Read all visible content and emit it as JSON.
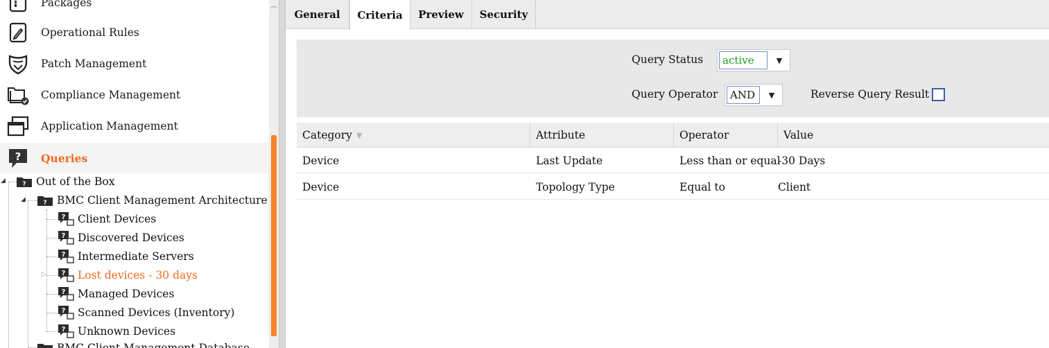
{
  "nav": {
    "items": [
      {
        "label": "Packages",
        "icon": "package-icon"
      },
      {
        "label": "Operational Rules",
        "icon": "operational-rules-icon"
      },
      {
        "label": "Patch Management",
        "icon": "shield-icon"
      },
      {
        "label": "Compliance Management",
        "icon": "compliance-folder-icon"
      },
      {
        "label": "Application Management",
        "icon": "application-windows-icon"
      },
      {
        "label": "Queries",
        "icon": "query-bubble-icon",
        "active": true
      }
    ]
  },
  "tree": {
    "root": "Out of the Box",
    "group": "BMC Client Management Architecture",
    "children": [
      "Client Devices",
      "Discovered Devices",
      "Intermediate Servers",
      "Lost devices - 30 days",
      "Managed Devices",
      "Scanned Devices (Inventory)",
      "Unknown Devices"
    ],
    "selected": "Lost devices - 30 days",
    "next_group": "BMC Client Management Database"
  },
  "tabs": [
    "General",
    "Criteria",
    "Preview",
    "Security"
  ],
  "active_tab": "Criteria",
  "criteria": {
    "status_label": "Query Status",
    "status_value": "active",
    "operator_label": "Query Operator",
    "operator_value": "AND",
    "reverse_label": "Reverse Query Result",
    "reverse_checked": false
  },
  "grid": {
    "headers": [
      "Category",
      "Attribute",
      "Operator",
      "Value"
    ],
    "rows": [
      [
        "Device",
        "Last Update",
        "Less than or equal",
        "-30 Days"
      ],
      [
        "Device",
        "Topology Type",
        "Equal to",
        "Client"
      ]
    ]
  },
  "colors": {
    "accent": "#f26a1b",
    "active_status": "#1e9a1e",
    "scroll_thumb": "#f7832a"
  }
}
